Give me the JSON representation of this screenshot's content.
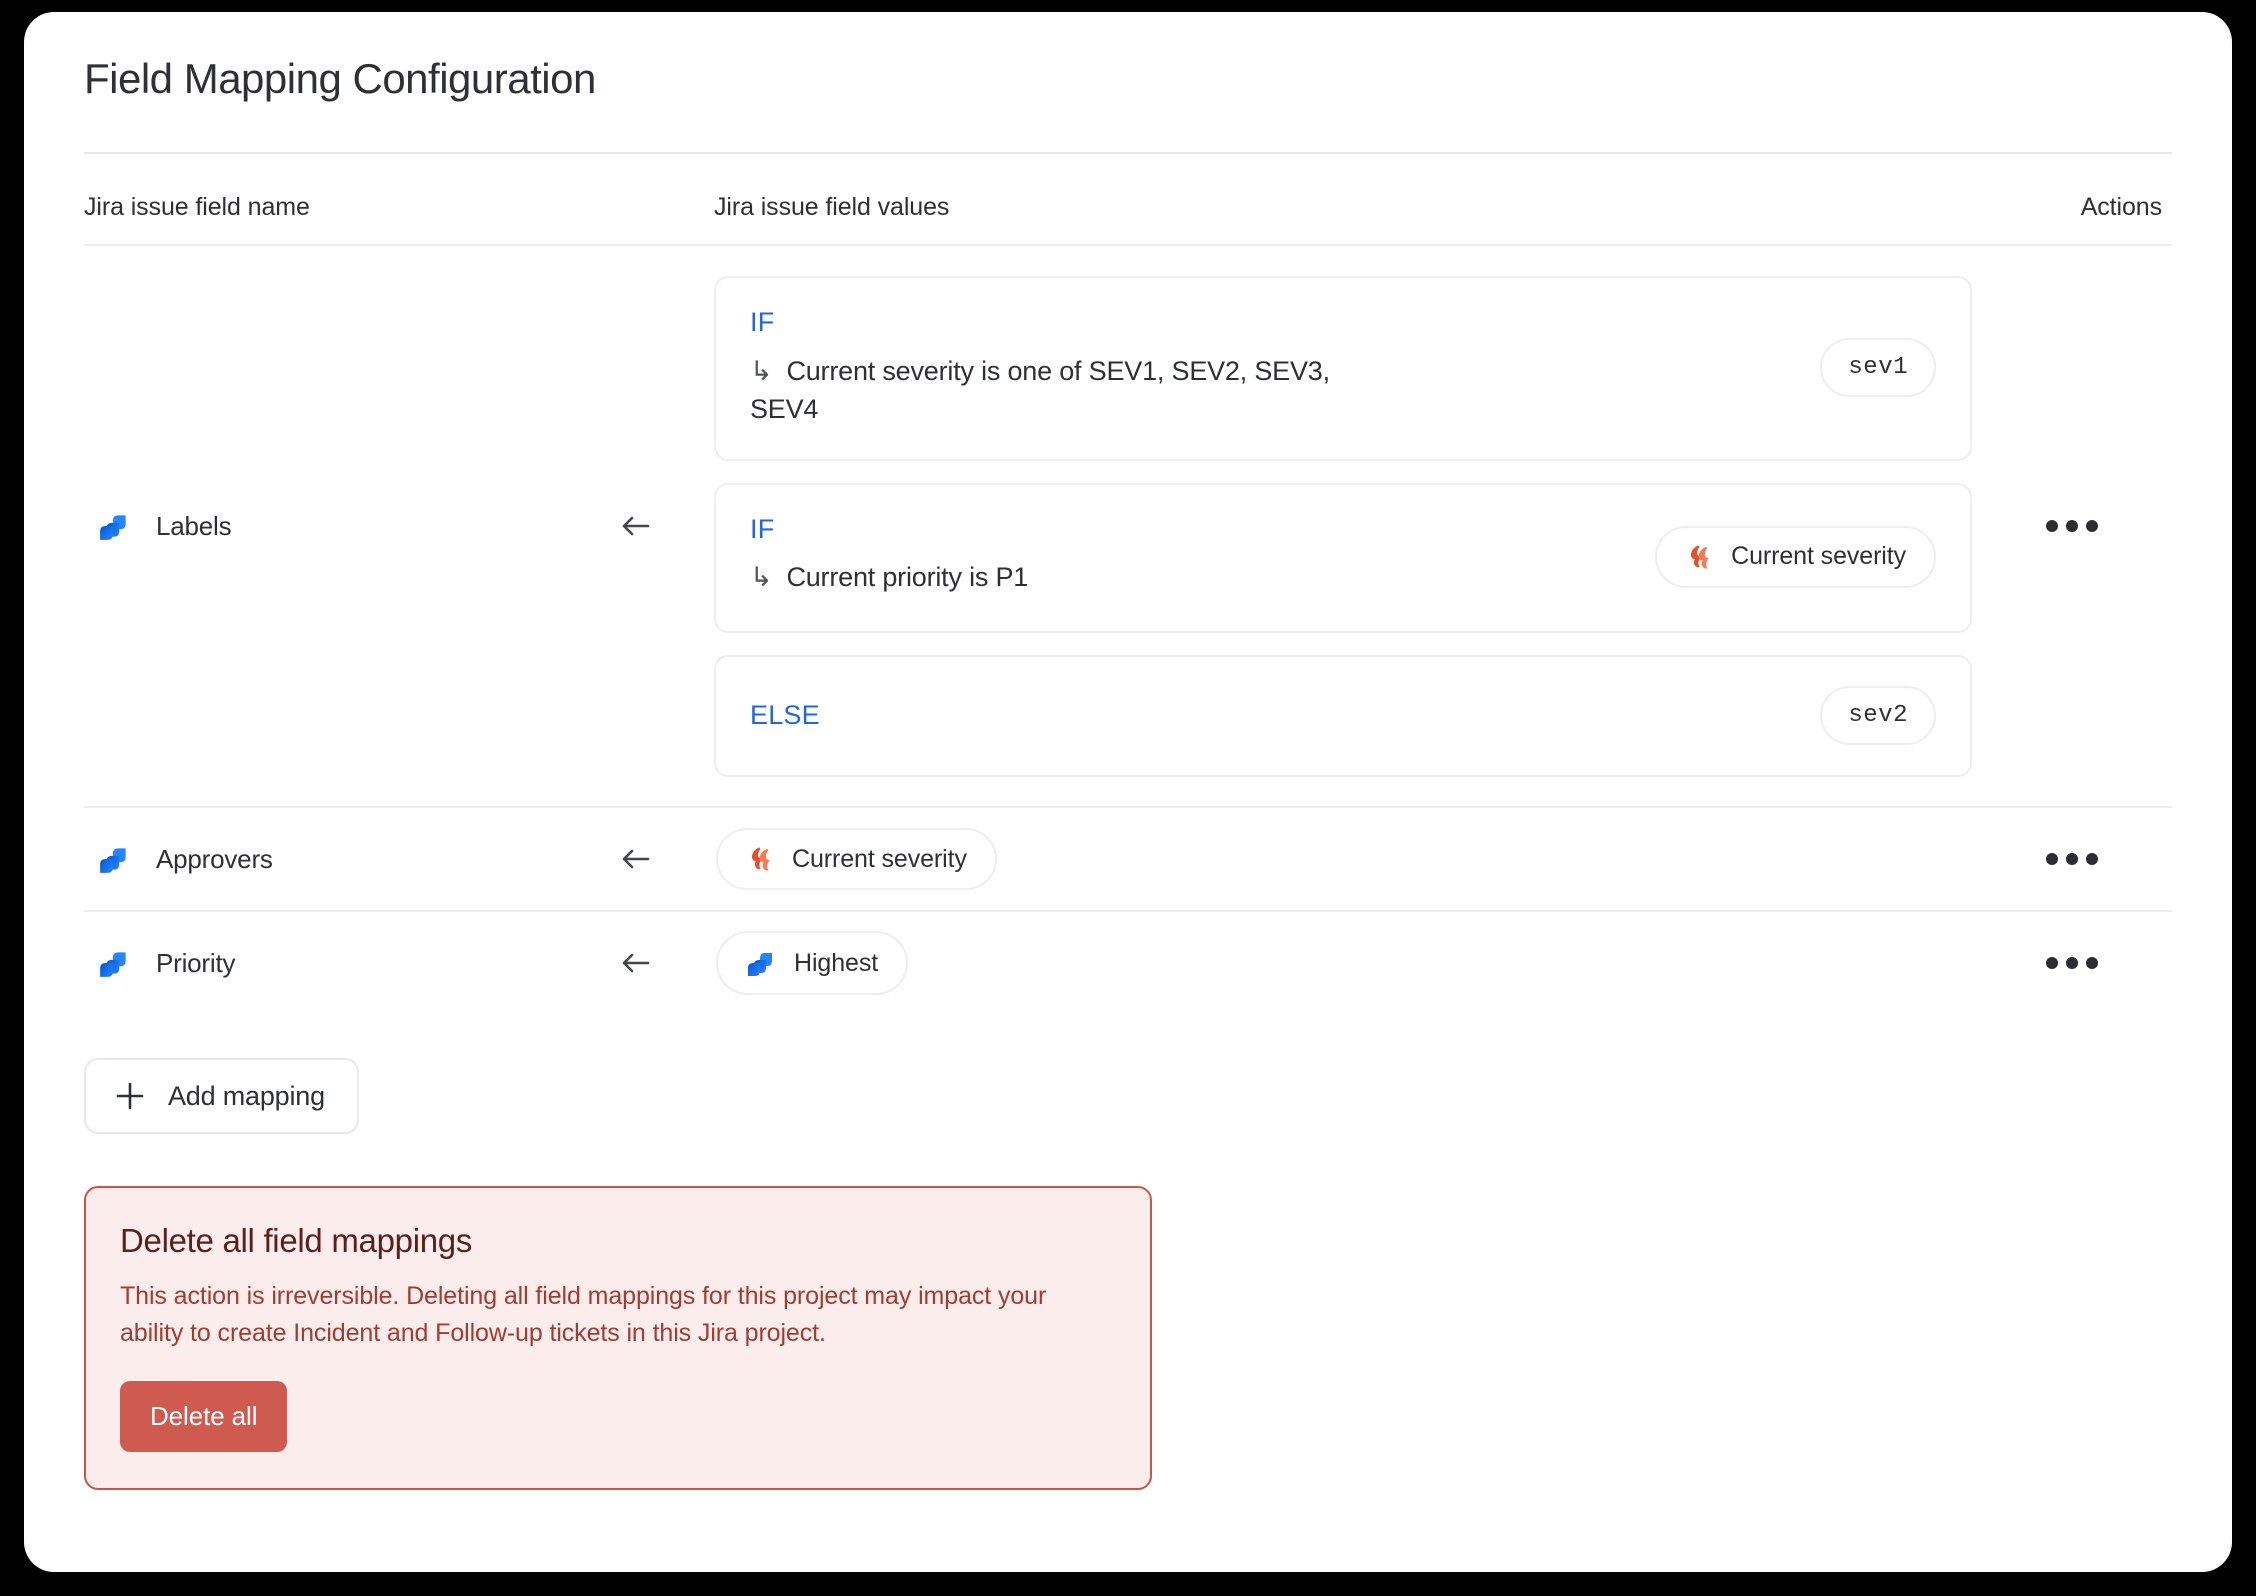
{
  "page": {
    "title": "Field Mapping Configuration"
  },
  "table": {
    "headers": {
      "field_name": "Jira issue field name",
      "field_values": "Jira issue field values",
      "actions": "Actions"
    },
    "rows": [
      {
        "field_icon": "jira-icon",
        "field_name": "Labels",
        "direction_icon": "arrow-left-icon",
        "actions_icon": "kebab-menu-icon",
        "conditions": [
          {
            "keyword": "IF",
            "condition_glyph": "↳",
            "condition_text": "Current severity is one of SEV1, SEV2, SEV3, SEV4",
            "value_pill": {
              "style": "mono",
              "icon": null,
              "label": "sev1"
            }
          },
          {
            "keyword": "IF",
            "condition_glyph": "↳",
            "condition_text": "Current priority is P1",
            "value_pill": {
              "style": "text",
              "icon": "incident-flame-icon",
              "label": "Current severity"
            }
          },
          {
            "keyword": "ELSE",
            "condition_glyph": null,
            "condition_text": null,
            "value_pill": {
              "style": "mono",
              "icon": null,
              "label": "sev2"
            }
          }
        ]
      },
      {
        "field_icon": "jira-icon",
        "field_name": "Approvers",
        "direction_icon": "arrow-left-icon",
        "actions_icon": "kebab-menu-icon",
        "value_pill": {
          "style": "text",
          "icon": "incident-flame-icon",
          "label": "Current severity"
        }
      },
      {
        "field_icon": "jira-icon",
        "field_name": "Priority",
        "direction_icon": "arrow-left-icon",
        "actions_icon": "kebab-menu-icon",
        "value_pill": {
          "style": "text",
          "icon": "jira-icon",
          "label": "Highest"
        }
      }
    ]
  },
  "add_mapping": {
    "icon": "plus-icon",
    "label": "Add mapping"
  },
  "danger_zone": {
    "title": "Delete all field mappings",
    "body": "This action is irreversible. Deleting all field mappings for this project may impact your ability to create Incident and Follow-up tickets in this Jira project.",
    "button_label": "Delete all"
  },
  "colors": {
    "keyword_blue": "#2563eb",
    "jira_blue": "#2684ff",
    "incident_orange": "#ef5a35",
    "danger_border": "#c9554a",
    "danger_bg": "#fbedeb",
    "danger_button": "#cf5b50",
    "text_primary": "#2f3037"
  }
}
